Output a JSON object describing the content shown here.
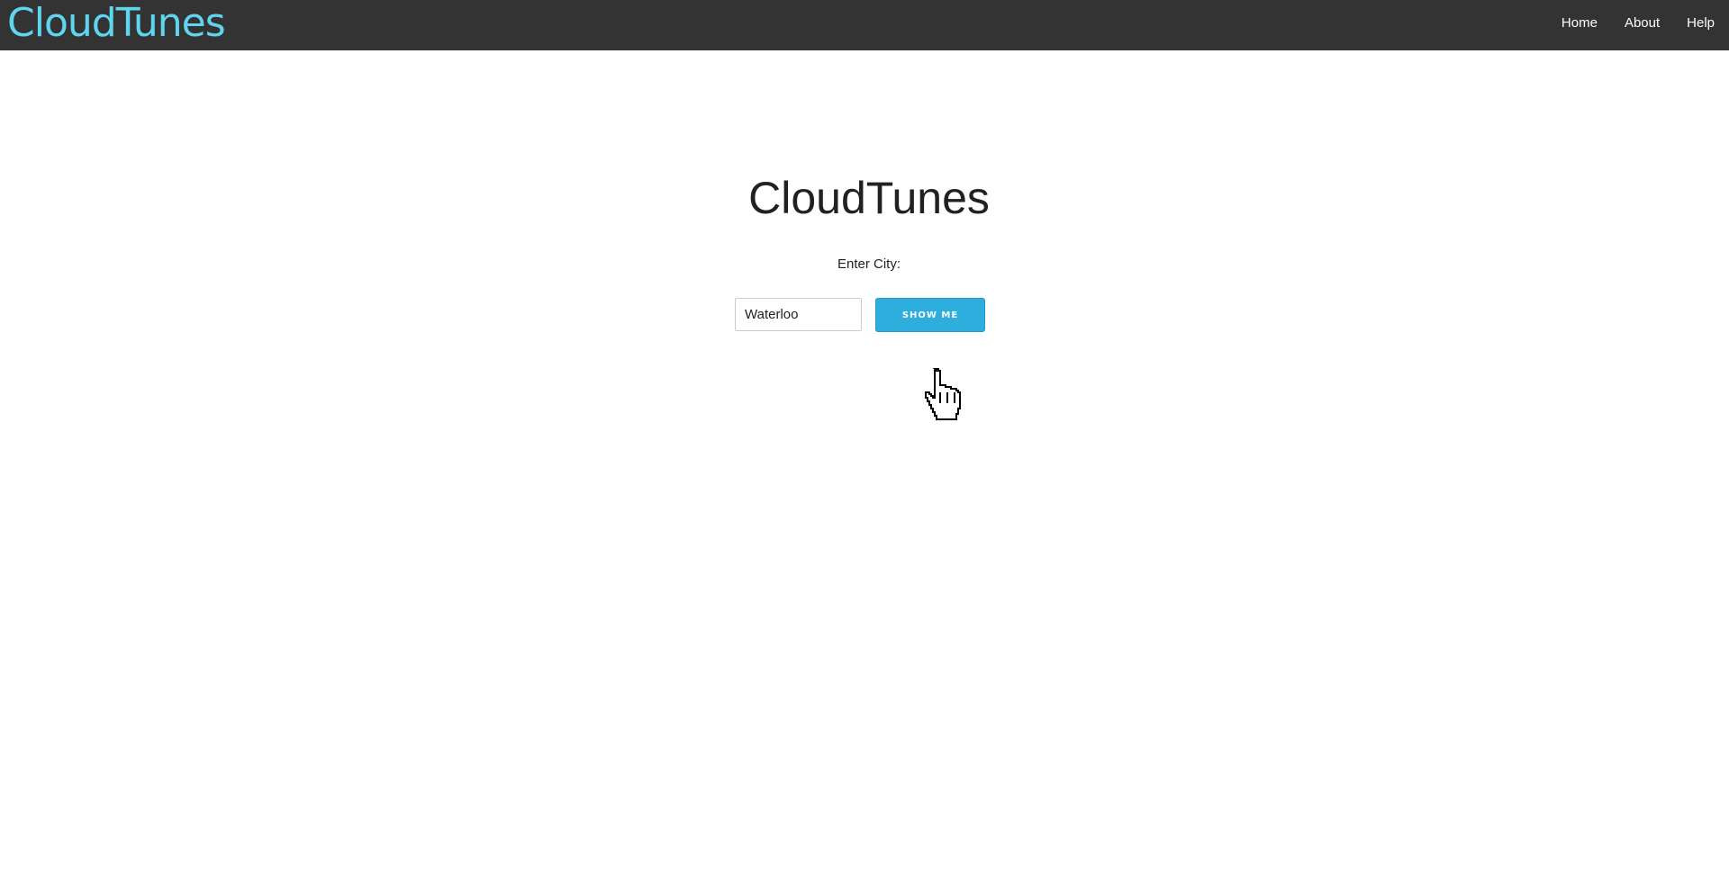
{
  "navbar": {
    "brand": "CloudTunes",
    "links": [
      {
        "label": "Home"
      },
      {
        "label": "About"
      },
      {
        "label": "Help"
      }
    ]
  },
  "main": {
    "title": "CloudTunes",
    "city_label": "Enter City:",
    "city_input": {
      "value": "Waterloo"
    },
    "submit_label": "SHOW ME"
  },
  "colors": {
    "navbar_bg": "#333333",
    "brand": "#5fd6ee",
    "button_bg": "#2eaedc"
  },
  "icons": {
    "cursor": "hand-pointer-icon"
  }
}
